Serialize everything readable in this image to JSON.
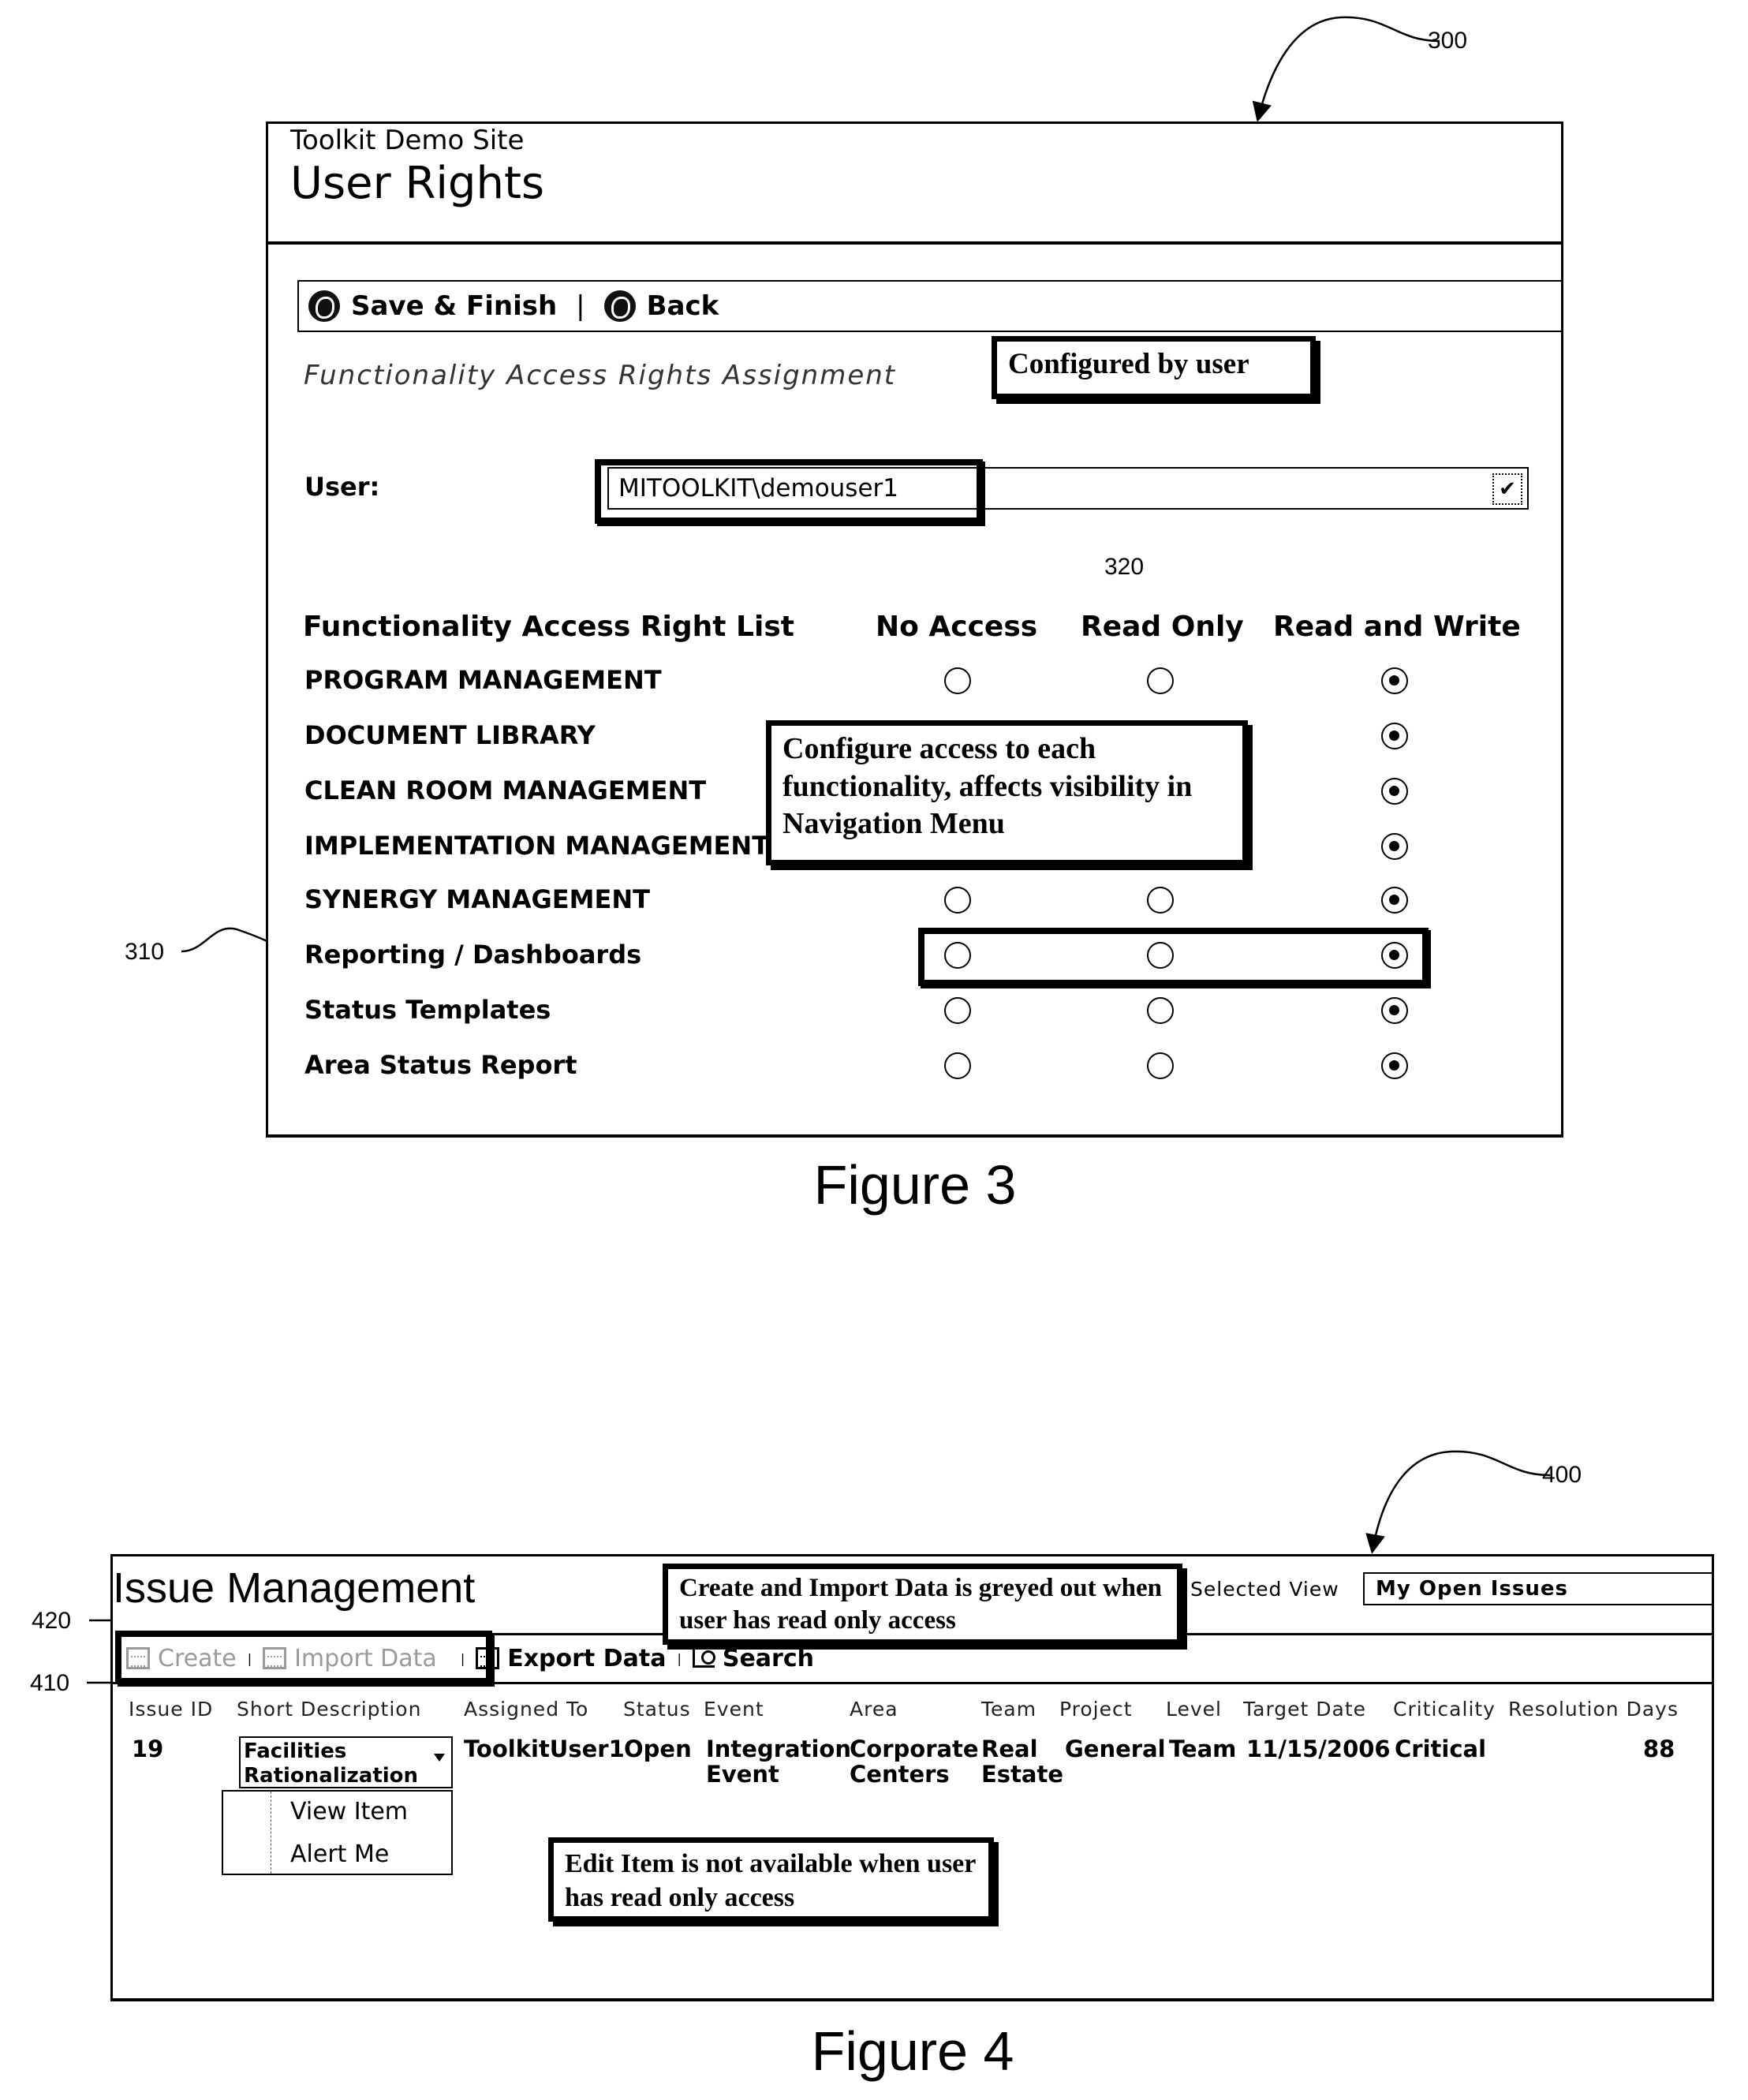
{
  "references": {
    "fig3": "300",
    "rights_list": "310",
    "user_select": "320",
    "fig4": "400",
    "toolbar_box": "410",
    "disabled_actions": "420"
  },
  "figure3": {
    "caption": "Figure 3",
    "site_name": "Toolkit Demo Site",
    "page_title": "User Rights",
    "toolbar": {
      "save_label": "Save & Finish",
      "separator": "|",
      "back_label": "Back",
      "save_icon": "globe-arrow-icon",
      "back_icon": "globe-back-icon"
    },
    "section_title": "Functionality Access Rights Assignment",
    "user_label": "User:",
    "user_value": "MITOOLKIT\\demouser1",
    "callout_configured": "Configured by user",
    "callout_access": "Configure access to each functionality, affects visibility in Navigation Menu",
    "columns": {
      "list": "Functionality Access Right List",
      "no_access": "No Access",
      "read_only": "Read Only",
      "read_write": "Read and Write"
    },
    "rights": [
      {
        "label": "PROGRAM MANAGEMENT",
        "value": "read_write",
        "options_visible": true
      },
      {
        "label": "DOCUMENT LIBRARY",
        "value": "read_write",
        "options_visible": false
      },
      {
        "label": "CLEAN ROOM MANAGEMENT",
        "value": "read_write",
        "options_visible": false
      },
      {
        "label": "IMPLEMENTATION MANAGEMENT",
        "value": "read_write",
        "options_visible": false
      },
      {
        "label": "SYNERGY MANAGEMENT",
        "value": "read_write",
        "options_visible": true
      },
      {
        "label": "Reporting / Dashboards",
        "value": "read_write",
        "options_visible": true
      },
      {
        "label": "Status Templates",
        "value": "read_write",
        "options_visible": true
      },
      {
        "label": "Area Status Report",
        "value": "read_write",
        "options_visible": true
      }
    ]
  },
  "figure4": {
    "caption": "Figure 4",
    "title": "Issue Management",
    "selected_view_label": "Selected View",
    "selected_view_value": "My Open Issues",
    "callout_greyed": "Create and Import Data is greyed out when user has read only access",
    "callout_edit": "Edit Item is not available when user has read only access",
    "toolbar": {
      "create": "Create",
      "import": "Import Data",
      "export": "Export Data",
      "search": "Search",
      "separator": "|"
    },
    "table": {
      "headers": [
        "Issue ID",
        "Short Description",
        "Assigned To",
        "Status",
        "Event",
        "Area",
        "Team",
        "Project",
        "Level",
        "Target Date",
        "Criticality",
        "Resolution Days"
      ],
      "row": {
        "issue_id": "19",
        "short_description_line1": "Facilities",
        "short_description_line2": "Rationalization",
        "assigned_to": "ToolkitUser1",
        "status": "Open",
        "event_line1": "Integration",
        "event_line2": "Event",
        "area_line1": "Corporate",
        "area_line2": "Centers",
        "team_line1": "Real",
        "team_line2": "Estate",
        "project": "General",
        "level": "Team",
        "target_date": "11/15/2006",
        "criticality": "Critical",
        "resolution_days": "88"
      }
    },
    "context_menu": [
      "View Item",
      "Alert Me"
    ]
  }
}
